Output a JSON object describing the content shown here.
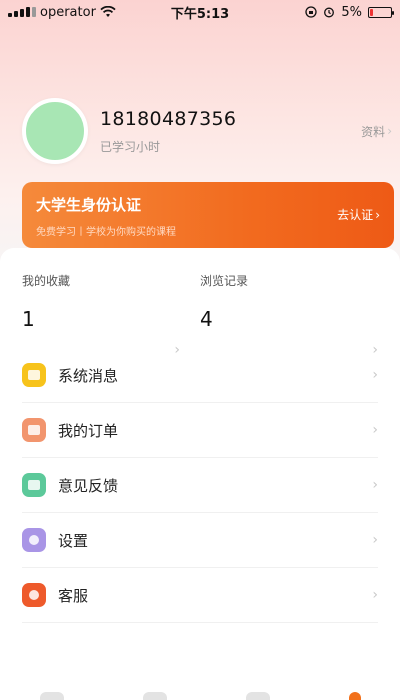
{
  "status_bar": {
    "carrier": "operator",
    "time": "下午5:13",
    "battery": "5%",
    "icons": [
      "signal-icon",
      "wifi-icon",
      "orientation-lock-icon",
      "alarm-icon",
      "battery-icon"
    ]
  },
  "profile": {
    "phone": "18180487356",
    "study_hours": "已学习小时",
    "profile_link": "资料"
  },
  "banner": {
    "title": "大学生身份认证",
    "subtitle": "免费学习丨学校为你购买的课程",
    "cta": "去认证"
  },
  "stats": [
    {
      "label": "我的收藏",
      "value": "1"
    },
    {
      "label": "浏览记录",
      "value": "4"
    }
  ],
  "menu": [
    {
      "label": "系统消息",
      "icon": "message-icon",
      "color": "#f7c31b"
    },
    {
      "label": "我的订单",
      "icon": "order-icon",
      "color": "#f2956e"
    },
    {
      "label": "意见反馈",
      "icon": "feedback-icon",
      "color": "#5cc99a"
    },
    {
      "label": "设置",
      "icon": "settings-icon",
      "color": "#a995e6"
    },
    {
      "label": "客服",
      "icon": "customer-service-icon",
      "color": "#ee5a2b"
    }
  ],
  "colors": {
    "accent": "#f26b1f",
    "avatar": "#a8e6b4"
  }
}
